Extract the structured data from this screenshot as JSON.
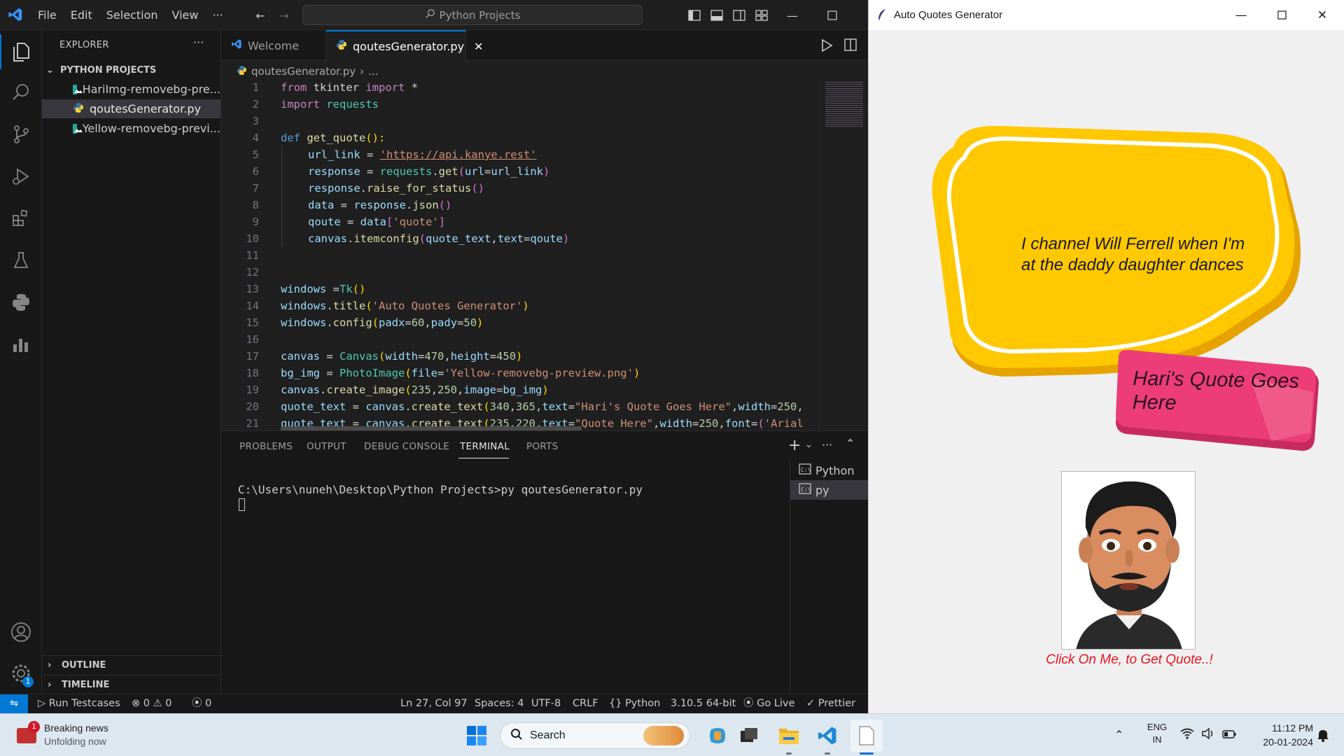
{
  "vscode": {
    "menu": [
      "File",
      "Edit",
      "Selection",
      "View",
      "···"
    ],
    "search_label": "Python Projects",
    "sidebar": {
      "title": "EXPLORER",
      "more": "···",
      "folder": "PYTHON PROJECTS",
      "files": [
        "HariImg-removebg-pre...",
        "qoutesGenerator.py",
        "Yellow-removebg-previ..."
      ],
      "outline": "OUTLINE",
      "timeline": "TIMELINE",
      "settings_badge": "1"
    },
    "tabs": [
      {
        "label": "Welcome"
      },
      {
        "label": "qoutesGenerator.py"
      }
    ],
    "breadcrumb": {
      "file": "qoutesGenerator.py",
      "more": "..."
    },
    "panel": {
      "tabs": [
        "PROBLEMS",
        "OUTPUT",
        "DEBUG CONSOLE",
        "TERMINAL",
        "PORTS"
      ],
      "terminal_line": "C:\\Users\\nuneh\\Desktop\\Python Projects>py qoutesGenerator.py",
      "terminals": [
        "Python",
        "py"
      ]
    },
    "status": {
      "run_testcases": "Run Testcases",
      "errors": "0",
      "warnings": "0",
      "ports": "0",
      "cursor": "Ln 27, Col 97",
      "spaces": "Spaces: 4",
      "encoding": "UTF-8",
      "eol": "CRLF",
      "language": "Python",
      "interpreter": "3.10.5 64-bit",
      "go_live": "Go Live",
      "prettier": "Prettier"
    }
  },
  "code_lines": [
    {
      "n": "1"
    },
    {
      "n": "2"
    },
    {
      "n": "3"
    },
    {
      "n": "4"
    },
    {
      "n": "5"
    },
    {
      "n": "6"
    },
    {
      "n": "7"
    },
    {
      "n": "8"
    },
    {
      "n": "9"
    },
    {
      "n": "10"
    },
    {
      "n": "11"
    },
    {
      "n": "12"
    },
    {
      "n": "13"
    },
    {
      "n": "14"
    },
    {
      "n": "15"
    },
    {
      "n": "16"
    },
    {
      "n": "17"
    },
    {
      "n": "18"
    },
    {
      "n": "19"
    },
    {
      "n": "20"
    },
    {
      "n": "21"
    }
  ],
  "code": {
    "l1": [
      "from",
      " tkinter ",
      "import",
      " *"
    ],
    "l2": [
      "import",
      " requests"
    ],
    "l4": [
      "def",
      " get_quote",
      "():"
    ],
    "l5": [
      "url_link",
      " = ",
      "'https://api.kanye.rest'"
    ],
    "l6": [
      "response",
      " = ",
      "requests",
      ".",
      "get",
      "(",
      "url",
      "=",
      "url_link",
      ")"
    ],
    "l7": [
      "response",
      ".",
      "raise_for_status",
      "()"
    ],
    "l8": [
      "data",
      " = ",
      "response",
      ".",
      "json",
      "()"
    ],
    "l9": [
      "qoute",
      " = ",
      "data",
      "[",
      "'quote'",
      "]"
    ],
    "l10": [
      "canvas",
      ".",
      "itemconfig",
      "(",
      "quote_text",
      ",",
      "text",
      "=",
      "qoute",
      ")"
    ],
    "l13": [
      "windows",
      " =",
      "Tk",
      "()"
    ],
    "l14": [
      "windows",
      ".",
      "title",
      "(",
      "'Auto Quotes Generator'",
      ")"
    ],
    "l15": [
      "windows",
      ".",
      "config",
      "(",
      "padx",
      "=",
      "60",
      ",",
      "pady",
      "=",
      "50",
      ")"
    ],
    "l17": [
      "canvas",
      " = ",
      "Canvas",
      "(",
      "width",
      "=",
      "470",
      ",",
      "height",
      "=",
      "450",
      ")"
    ],
    "l18": [
      "bg_img",
      " = ",
      "PhotoImage",
      "(",
      "file",
      "=",
      "'Yellow-removebg-preview.png'",
      ")"
    ],
    "l19": [
      "canvas",
      ".",
      "create_image",
      "(",
      "235",
      ",",
      "250",
      ",",
      "image",
      "=",
      "bg_img",
      ")"
    ],
    "l20": [
      "quote_text",
      " = ",
      "canvas",
      ".",
      "create_text",
      "(",
      "340",
      ",",
      "365",
      ",",
      "text",
      "=",
      "\"Hari's Quote Goes Here\"",
      ",",
      "width",
      "=",
      "250",
      ","
    ],
    "l21": [
      "quote_text",
      " = ",
      "canvas",
      ".",
      "create_text",
      "(",
      "235",
      ",",
      "220",
      ",",
      "text",
      "=",
      "\"Quote Here\"",
      ",",
      "width",
      "=",
      "250",
      ",",
      "font",
      "=",
      "(",
      "'Arial"
    ]
  },
  "tk": {
    "title": "Auto Quotes Generator",
    "quote": "I channel Will Ferrell when I'm at the daddy daughter dances",
    "tag": "Hari's Quote Goes Here",
    "click_label": "Click On Me, to Get Quote..!",
    "colors": {
      "bubble": "#ffc800",
      "tag": "#ec3d78",
      "click_text": "#e8141f"
    }
  },
  "taskbar": {
    "news_badge": "1",
    "news_title": "Breaking news",
    "news_sub": "Unfolding now",
    "search": "Search",
    "lang1": "ENG",
    "lang2": "IN",
    "time": "11:12 PM",
    "date": "20-01-2024"
  }
}
